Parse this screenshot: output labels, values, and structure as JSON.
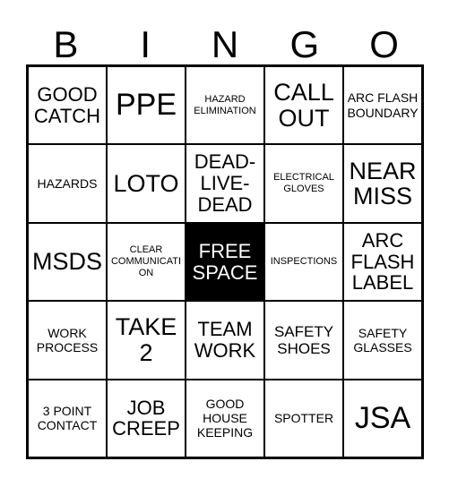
{
  "card": {
    "title": "BINGO",
    "header_letters": [
      "B",
      "I",
      "N",
      "G",
      "O"
    ],
    "colors": {
      "grid_line": "#000000",
      "cell_background": "#ffffff",
      "cell_text": "#000000",
      "free_space_background": "#000000",
      "free_space_text": "#ffffff"
    },
    "rows": [
      [
        {
          "label": "GOOD\nCATCH",
          "size": "l",
          "free": false
        },
        {
          "label": "PPE",
          "size": "xxl",
          "free": false
        },
        {
          "label": "HAZARD\nELIMINATION",
          "size": "xs",
          "free": false
        },
        {
          "label": "CALL\nOUT",
          "size": "xl",
          "free": false
        },
        {
          "label": "ARC FLASH\nBOUNDARY",
          "size": "s",
          "free": false
        }
      ],
      [
        {
          "label": "HAZARDS",
          "size": "s",
          "free": false
        },
        {
          "label": "LOTO",
          "size": "xl",
          "free": false
        },
        {
          "label": "DEAD-\nLIVE-\nDEAD",
          "size": "l",
          "free": false
        },
        {
          "label": "ELECTRICAL\nGLOVES",
          "size": "xs",
          "free": false
        },
        {
          "label": "NEAR\nMISS",
          "size": "xl",
          "free": false
        }
      ],
      [
        {
          "label": "MSDS",
          "size": "xl",
          "free": false
        },
        {
          "label": "CLEAR\nCOMMUNICATION",
          "size": "xs",
          "free": false
        },
        {
          "label": "FREE\nSPACE",
          "size": "l",
          "free": true
        },
        {
          "label": "INSPECTIONS",
          "size": "xs",
          "free": false
        },
        {
          "label": "ARC\nFLASH\nLABEL",
          "size": "l",
          "free": false
        }
      ],
      [
        {
          "label": "WORK\nPROCESS",
          "size": "s",
          "free": false
        },
        {
          "label": "TAKE\n2",
          "size": "xl",
          "free": false
        },
        {
          "label": "TEAM\nWORK",
          "size": "l",
          "free": false
        },
        {
          "label": "SAFETY\nSHOES",
          "size": "m",
          "free": false
        },
        {
          "label": "SAFETY\nGLASSES",
          "size": "s",
          "free": false
        }
      ],
      [
        {
          "label": "3 POINT\nCONTACT",
          "size": "s",
          "free": false
        },
        {
          "label": "JOB\nCREEP",
          "size": "l",
          "free": false
        },
        {
          "label": "GOOD\nHOUSE\nKEEPING",
          "size": "s",
          "free": false
        },
        {
          "label": "SPOTTER",
          "size": "s",
          "free": false
        },
        {
          "label": "JSA",
          "size": "xxl",
          "free": false
        }
      ]
    ]
  }
}
